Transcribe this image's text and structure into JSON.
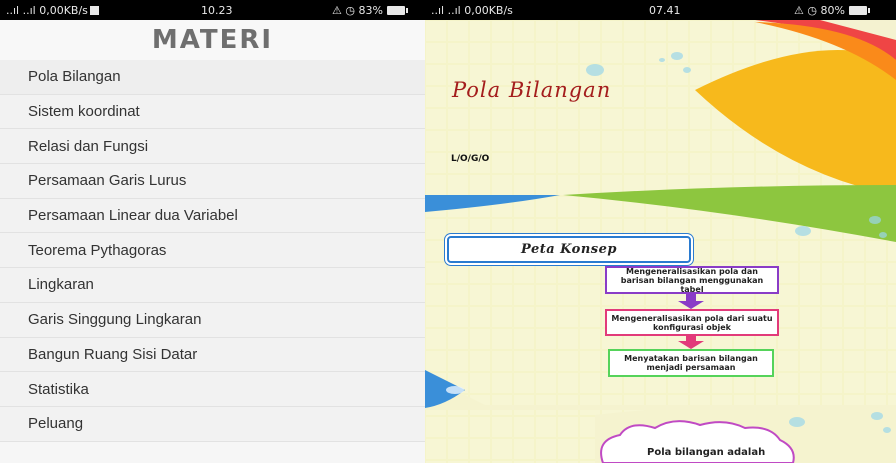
{
  "status_left": {
    "network": "..ıl ..ıl 0,00KB/s",
    "time": "10.23",
    "battery": "⚠ ◷ 83%"
  },
  "status_right": {
    "network": "..ıl ..ıl 0,00KB/s",
    "time": "07.41",
    "battery": "⚠ ◷ 80%"
  },
  "materi": {
    "title": "MATERI",
    "items": [
      "Pola Bilangan",
      "Sistem koordinat",
      "Relasi dan Fungsi",
      "Persamaan Garis Lurus",
      "Persamaan Linear dua Variabel",
      "Teorema Pythagoras",
      "Lingkaran",
      "Garis Singgung Lingkaran",
      "Bangun Ruang Sisi Datar",
      "Statistika",
      "Peluang"
    ]
  },
  "slide": {
    "title": "Pola Bilangan",
    "logo": "L/O/G/O",
    "concept_title": "Peta Konsep",
    "flow": [
      "Mengeneralisasikan pola dan barisan bilangan menggunakan tabel",
      "Mengeneralisasikan pola dari suatu konfigurasi objek",
      "Menyatakan barisan bilangan menjadi persamaan"
    ],
    "cloud_text": "Pola bilangan adalah"
  }
}
